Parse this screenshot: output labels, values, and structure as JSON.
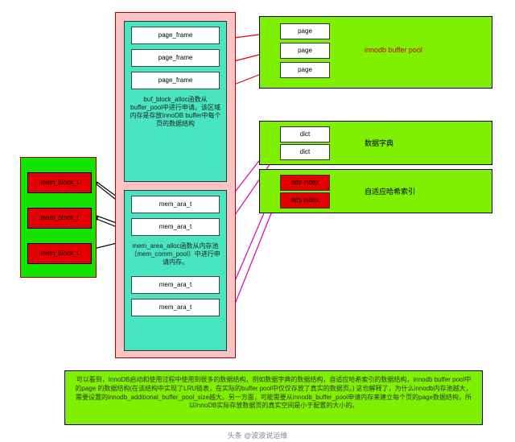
{
  "left": {
    "blocks": [
      "mem_block_t",
      "mem_block_t",
      "mem_block_t"
    ]
  },
  "middle": {
    "frame_group": {
      "slots": [
        "page_frame",
        "page_frame",
        "page_frame"
      ],
      "desc": "buf_block_alloc函数从buffer_pool中进行申请。该区域内存是存放InnoDB buffer中每个页的数据结构"
    },
    "area_group": {
      "slots_top": [
        "mem_ara_t",
        "mem_ara_t"
      ],
      "desc": "mem_area_alloc函数从内存池（mem_comm_pool）中进行申请内存。",
      "slots_bottom": [
        "mem_ara_t",
        "mem_ara_t"
      ]
    }
  },
  "right": {
    "buffer_pool": {
      "label": "innodb buffer pool",
      "pages": [
        "page",
        "page",
        "page"
      ]
    },
    "dict": {
      "label": "数据字典",
      "items": [
        "dict",
        "dict"
      ]
    },
    "adp": {
      "label": "自适应哈希索引",
      "items": [
        "adp index",
        "adp index"
      ]
    }
  },
  "note": "可以看到，InnoDB启动和使用过程中使用到很多的数据结构，例如数据字典的数据结构，自适应哈希索引的数据结构，innodb buffer pool中的page 的数据结构(在该结构中实现了LRU链表，在实际的buffer pool中仅仅存放了真实的数据页。) 这也解释了，为什么innodb内存池越大，需要设置的innodb_additional_buffer_pool_size越大。另一方面，可能需要从innodb_buffer_pool申请内存来建立每个页的page数据结构，所以InnoDB实际存放数据页的真实空间是小于配置的大小的。",
  "watermark": "头条 @波波说运维"
}
